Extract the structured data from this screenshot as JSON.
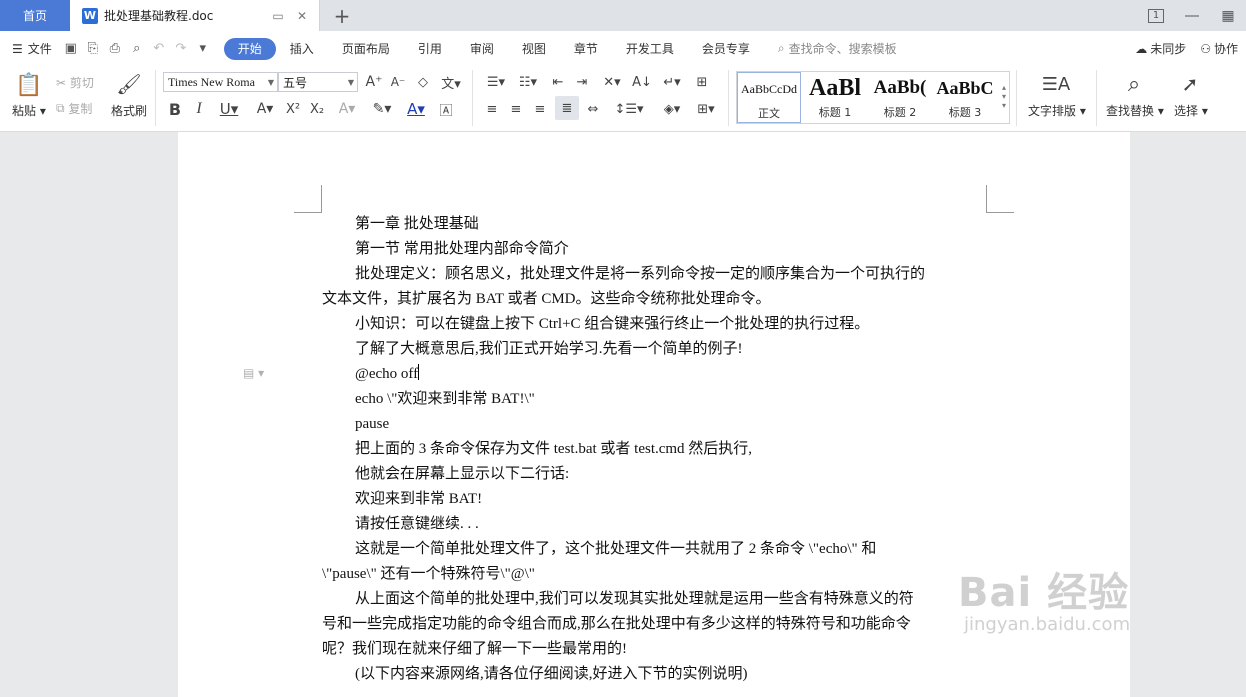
{
  "titlebar": {
    "home_tab": "首页",
    "doc_tab": "批处理基础教程.doc",
    "new_tab": "+",
    "window_badge": "1"
  },
  "menubar": {
    "file": "文件",
    "tabs": [
      "开始",
      "插入",
      "页面布局",
      "引用",
      "审阅",
      "视图",
      "章节",
      "开发工具",
      "会员专享"
    ],
    "active_tab": "开始",
    "search_placeholder": "查找命令、搜索模板",
    "sync": "未同步",
    "collab": "协作"
  },
  "ribbon": {
    "paste": "粘贴",
    "cut": "剪切",
    "copy": "复制",
    "format_painter": "格式刷",
    "font_name": "Times New Roma",
    "font_size": "五号",
    "styles": [
      {
        "sample": "AaBbCcDd",
        "name": "正文"
      },
      {
        "sample": "AaBl",
        "name": "标题 1"
      },
      {
        "sample": "AaBb(",
        "name": "标题 2"
      },
      {
        "sample": "AaBbC",
        "name": "标题 3"
      }
    ],
    "text_layout": "文字排版",
    "find_replace": "查找替换",
    "select": "选择"
  },
  "document": {
    "lines": [
      {
        "text": "第一章  批处理基础",
        "indent": true
      },
      {
        "text": "第一节  常用批处理内部命令简介",
        "indent": true
      },
      {
        "text": "批处理定义：顾名思义，批处理文件是将一系列命令按一定的顺序集合为一个可执行的",
        "indent": true
      },
      {
        "text": "文本文件，其扩展名为 BAT 或者 CMD。这些命令统称批处理命令。",
        "indent": false
      },
      {
        "text": "小知识：可以在键盘上按下 Ctrl+C 组合键来强行终止一个批处理的执行过程。",
        "indent": true
      },
      {
        "text": "了解了大概意思后,我们正式开始学习.先看一个简单的例子!",
        "indent": true
      },
      {
        "text": "@echo off",
        "indent": true
      },
      {
        "text": "echo \\\"欢迎来到非常 BAT!\\\"",
        "indent": true
      },
      {
        "text": "pause",
        "indent": true
      },
      {
        "text": "把上面的 3 条命令保存为文件 test.bat 或者 test.cmd 然后执行,",
        "indent": true
      },
      {
        "text": "他就会在屏幕上显示以下二行话:",
        "indent": true
      },
      {
        "text": "欢迎来到非常 BAT!",
        "indent": true
      },
      {
        "text": "请按任意键继续. . .",
        "indent": true
      },
      {
        "text": " 这就是一个简单批处理文件了，这个批处理文件一共就用了 2 条命令  \\\"echo\\\"  和",
        "indent": true
      },
      {
        "text": "\\\"pause\\\"  还有一个特殊符号\\\"@\\\"",
        "indent": false
      },
      {
        "text": "从上面这个简单的批处理中,我们可以发现其实批处理就是运用一些含有特殊意义的符",
        "indent": true
      },
      {
        "text": "号和一些完成指定功能的命令组合而成,那么在批处理中有多少这样的特殊符号和功能命令",
        "indent": false
      },
      {
        "text": "呢？我们现在就来仔细了解一下一些最常用的!",
        "indent": false
      },
      {
        "text": "(以下内容来源网络,请各位仔细阅读,好进入下节的实例说明)",
        "indent": true
      }
    ]
  },
  "watermark": {
    "main": "Bai 经验",
    "sub": "jingyan.baidu.com"
  },
  "colors": {
    "accent": "#4b79d6",
    "page_bg": "#ffffff",
    "canvas_bg": "#e8e9eb"
  }
}
